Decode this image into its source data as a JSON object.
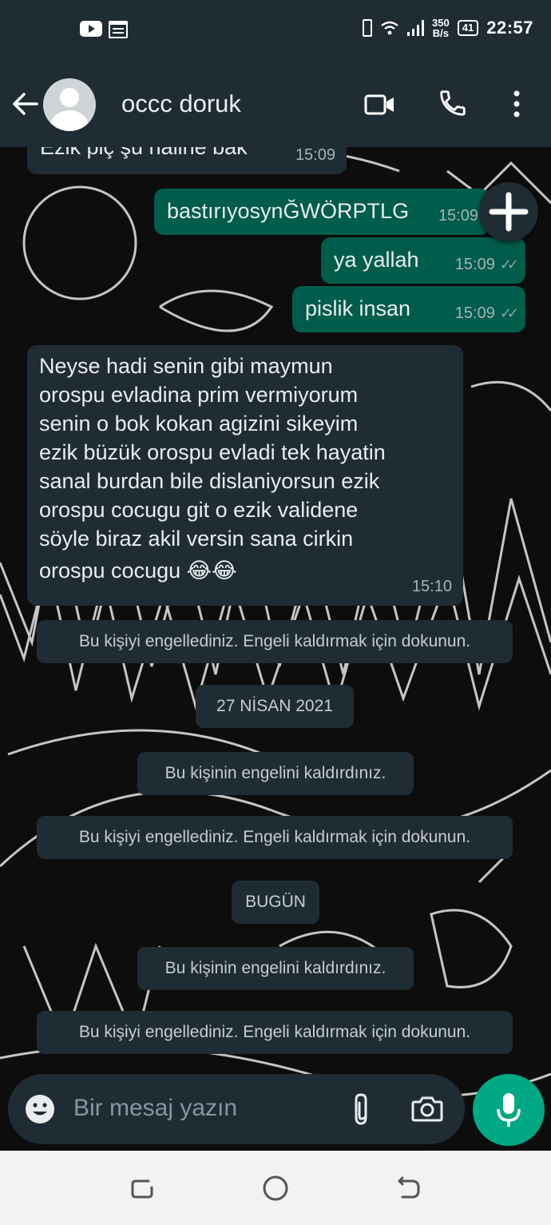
{
  "status_bar": {
    "time": "22:57",
    "net_speed_value": "350",
    "net_speed_unit": "B/s",
    "battery": "41"
  },
  "header": {
    "contact_name": "occc doruk"
  },
  "messages": [
    {
      "text": "Ezik piç şu haline bak",
      "time": "15:09"
    },
    {
      "text": "bastırıyosynĞWÖRPTLG",
      "time": "15:09"
    },
    {
      "text": "ya yallah",
      "time": "15:09"
    },
    {
      "text": "pislik insan",
      "time": "15:09"
    },
    {
      "lines": [
        "Neyse hadi senin gibi maymun",
        "orospu evladina prim vermiyorum",
        "senin o bok kokan agizini sikeyim",
        "ezik büzük orospu evladi tek hayatin",
        "sanal burdan bile dislaniyorsun ezik",
        "orospu cocugu git o ezik validene",
        "söyle biraz akil versin sana cirkin",
        "orospu cocugu 😂😂"
      ],
      "time": "15:10"
    }
  ],
  "system": {
    "blocked": "Bu kişiyi engellediniz. Engeli kaldırmak için dokunun.",
    "unblocked": "Bu kişinin engelini kaldırdınız.",
    "date_1": "27 NİSAN 2021",
    "date_2": "BUGÜN"
  },
  "input": {
    "placeholder": "Bir mesaj yazın"
  }
}
